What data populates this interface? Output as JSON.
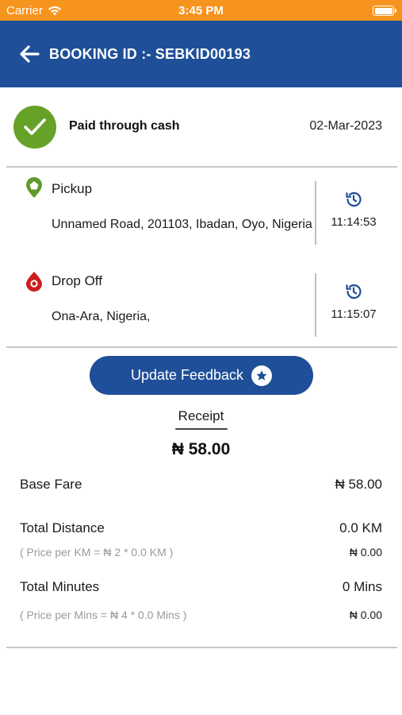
{
  "status_bar": {
    "carrier": "Carrier",
    "time": "3:45 PM"
  },
  "header": {
    "title": "BOOKING ID :- SEBKID00193"
  },
  "payment": {
    "status": "Paid through cash",
    "date": "02-Mar-2023"
  },
  "pickup": {
    "label": "Pickup",
    "address": "Unnamed Road, 201103, Ibadan, Oyo, Nigeria",
    "time": "11:14:53"
  },
  "dropoff": {
    "label": "Drop Off",
    "address": "Ona-Ara, Nigeria,",
    "time": "11:15:07"
  },
  "feedback_button": {
    "label": "Update Feedback"
  },
  "receipt": {
    "title": "Receipt",
    "total": "₦ 58.00",
    "base_fare": {
      "label": "Base Fare",
      "value": "₦ 58.00"
    },
    "total_distance": {
      "label": "Total Distance",
      "value": "0.0 KM",
      "detail": "( Price per KM = ₦ 2 * 0.0 KM )",
      "detail_value": "₦ 0.00"
    },
    "total_minutes": {
      "label": "Total Minutes",
      "value": "0 Mins",
      "detail": "( Price per Mins = ₦ 4 * 0.0 Mins )",
      "detail_value": "₦ 0.00"
    }
  },
  "colors": {
    "header": "#1f4f98",
    "status_bar": "#f7941d",
    "success": "#66a227",
    "pickup_pin": "#5f9a2a",
    "dropoff_pin": "#cc1e1e"
  }
}
